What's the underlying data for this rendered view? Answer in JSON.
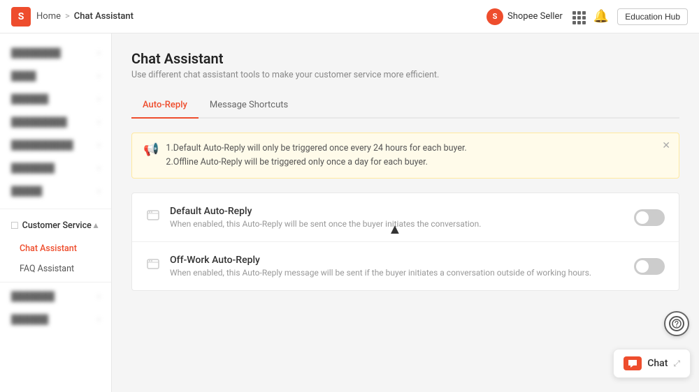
{
  "header": {
    "logo_text": "S",
    "home_label": "Home",
    "separator": ">",
    "page_title": "Chat Assistant",
    "seller_label": "Shopee Seller",
    "education_hub_label": "Education Hub"
  },
  "sidebar": {
    "blurred_items": [
      "Blurred 1",
      "Blurred 2",
      "Blurred 3",
      "Blurred 4",
      "Blurred 5",
      "Blurred 6",
      "Blurred 7"
    ],
    "customer_service_label": "Customer Service",
    "chat_assistant_label": "Chat Assistant",
    "faq_assistant_label": "FAQ Assistant",
    "more_items": [
      "Blurred 8",
      "Blurred 9"
    ]
  },
  "main": {
    "title": "Chat Assistant",
    "subtitle": "Use different chat assistant tools to make your customer service more efficient.",
    "tabs": [
      {
        "id": "auto-reply",
        "label": "Auto-Reply",
        "active": true
      },
      {
        "id": "message-shortcuts",
        "label": "Message Shortcuts",
        "active": false
      }
    ],
    "alert": {
      "line1": "1.Default Auto-Reply will only be triggered once every 24 hours for each buyer.",
      "line2": "2.Offline Auto-Reply will be triggered only once a day for each buyer."
    },
    "cards": [
      {
        "id": "default-auto-reply",
        "title": "Default Auto-Reply",
        "description": "When enabled, this Auto-Reply will be sent once the buyer initiates the conversation.",
        "enabled": false
      },
      {
        "id": "off-work-auto-reply",
        "title": "Off-Work Auto-Reply",
        "description": "When enabled, this Auto-Reply message will be sent if the buyer initiates a conversation outside of working hours.",
        "enabled": false
      }
    ]
  },
  "chat_button": {
    "label": "Chat",
    "icon": "💬"
  },
  "icons": {
    "grid": "⋯",
    "bell": "🔔",
    "megaphone": "📢",
    "chat_bubble": "💬",
    "expand": "⤢"
  }
}
